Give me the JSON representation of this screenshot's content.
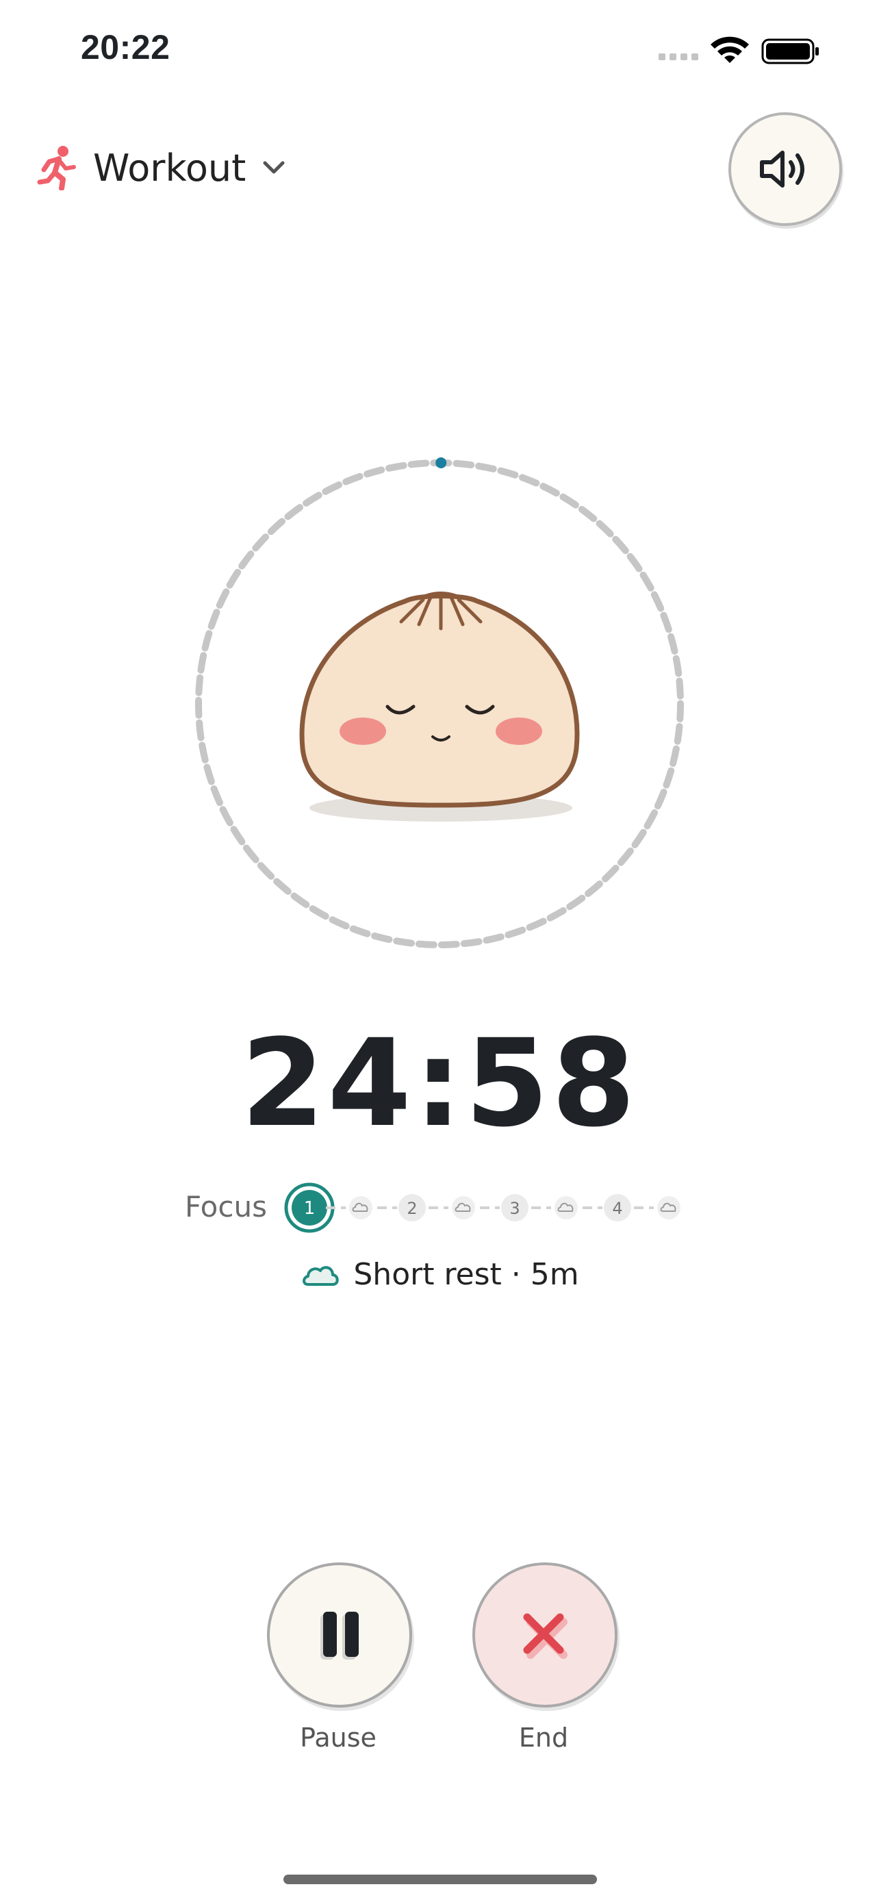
{
  "status_bar": {
    "time": "20:22"
  },
  "header": {
    "mode": {
      "label": "Workout",
      "icon": "running-person-icon"
    },
    "sound_button": {
      "icon": "speaker-volume-icon"
    }
  },
  "timer": {
    "time": "24:58",
    "progress_fraction": 0.001,
    "ring_color": "#c6c6c6",
    "progress_color": "#1b7fa0",
    "mascot": "sleeping-dumpling"
  },
  "session": {
    "focus_label": "Focus",
    "steps": [
      {
        "type": "focus",
        "label": "1",
        "active": true
      },
      {
        "type": "rest"
      },
      {
        "type": "focus",
        "label": "2"
      },
      {
        "type": "rest"
      },
      {
        "type": "focus",
        "label": "3"
      },
      {
        "type": "rest"
      },
      {
        "type": "focus",
        "label": "4"
      },
      {
        "type": "rest"
      }
    ],
    "next_label": "Short rest · 5m",
    "next_icon": "cloud-icon",
    "accent_color": "#1e8a7f"
  },
  "controls": {
    "pause": {
      "label": "Pause",
      "icon": "pause-icon",
      "bg": "#f9f7ef"
    },
    "end": {
      "label": "End",
      "icon": "close-x-icon",
      "bg": "#f8e3e3",
      "icon_color": "#e0464f"
    }
  }
}
